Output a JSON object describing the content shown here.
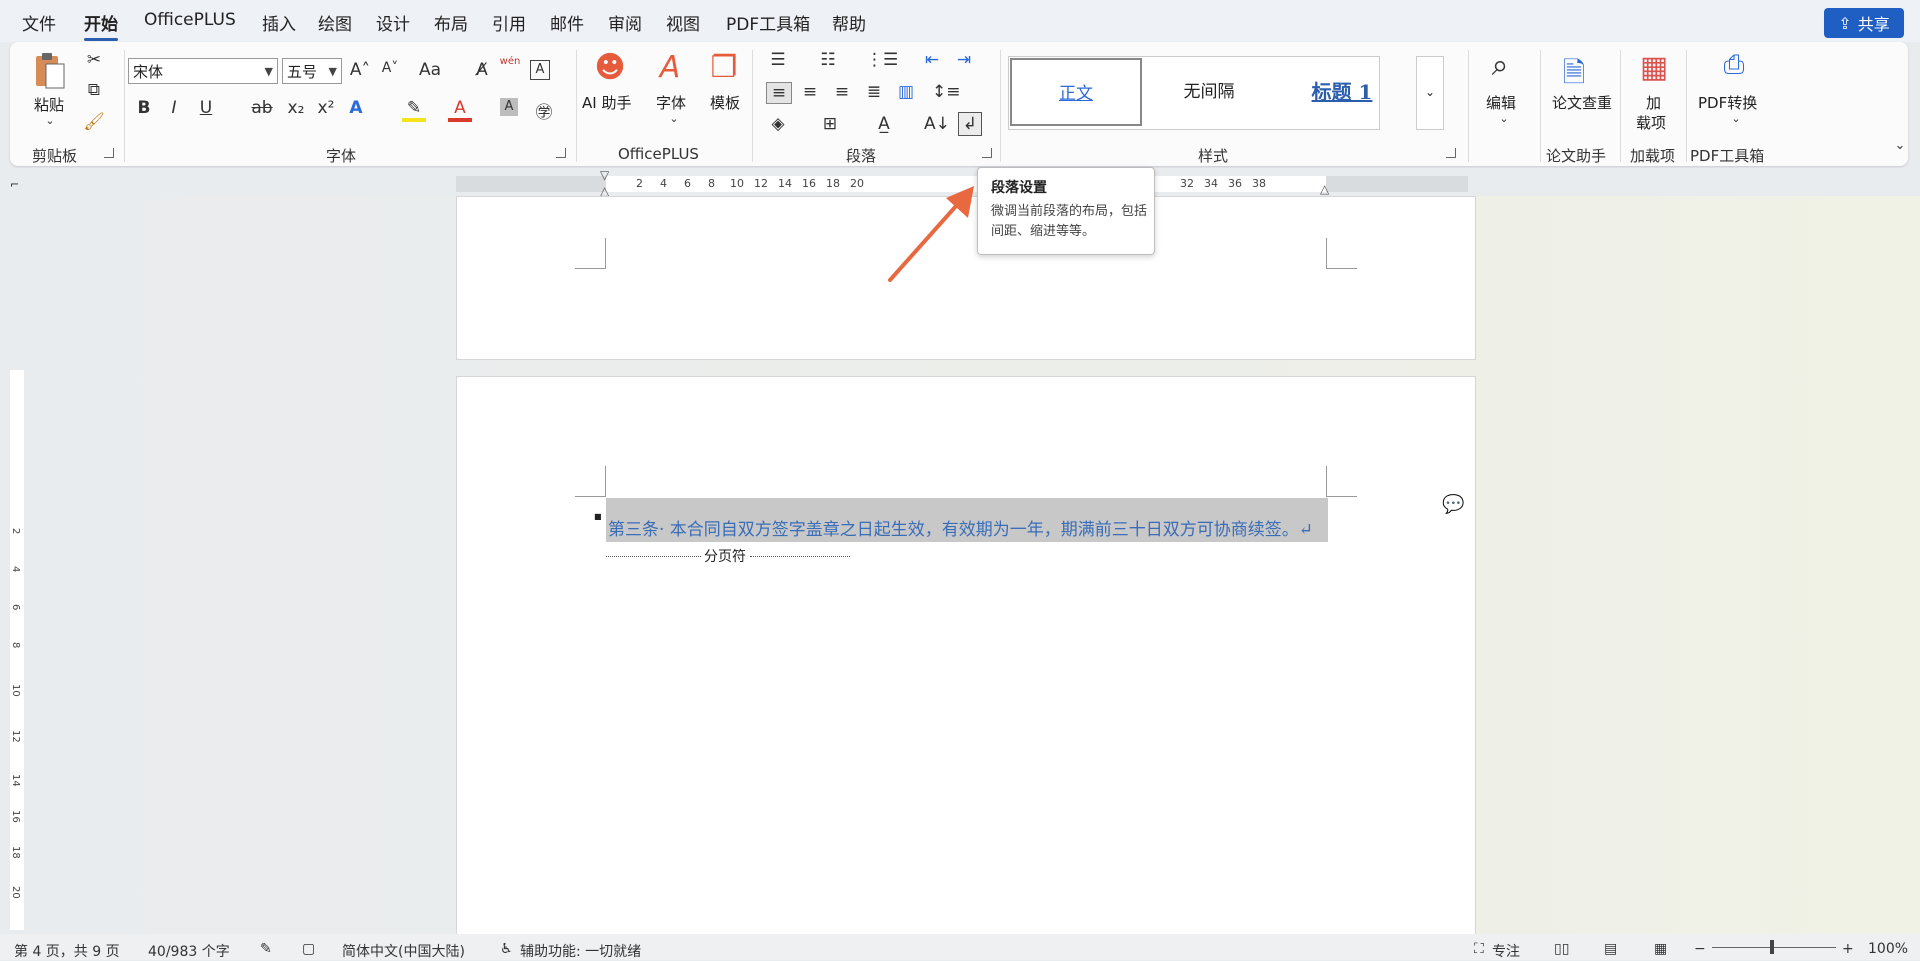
{
  "menu": {
    "items": [
      "文件",
      "开始",
      "OfficePLUS",
      "插入",
      "绘图",
      "设计",
      "布局",
      "引用",
      "邮件",
      "审阅",
      "视图",
      "PDF工具箱",
      "帮助"
    ],
    "active": "开始",
    "share_label": "共享"
  },
  "ribbon": {
    "clipboard": {
      "paste_label": "粘贴",
      "group_label": "剪贴板"
    },
    "font": {
      "font_name": "宋体",
      "font_size": "五号",
      "group_label": "字体",
      "change_case": "Aa",
      "phonetic": "wén"
    },
    "officeplus": {
      "ai_label": "AI 助手",
      "font_label": "字体",
      "template_label": "模板",
      "group_label": "OfficePLUS"
    },
    "paragraph": {
      "group_label": "段落"
    },
    "styles": {
      "items": [
        "正文",
        "无间隔",
        "标题 1"
      ],
      "group_label": "样式"
    },
    "editing": {
      "label": "编辑"
    },
    "paper": {
      "button_label": "论文查重",
      "group_label": "论文助手"
    },
    "addins": {
      "button_label_1": "加",
      "button_label_2": "载项",
      "group_label": "加载项"
    },
    "pdf": {
      "button_label": "PDF转换",
      "group_label": "PDF工具箱"
    }
  },
  "ruler": {
    "numbers": [
      "2",
      "4",
      "6",
      "8",
      "10",
      "12",
      "14",
      "16",
      "18",
      "20",
      "32",
      "34",
      "36",
      "38"
    ],
    "v_numbers": [
      "2",
      "4",
      "6",
      "8",
      "10",
      "12",
      "14",
      "16",
      "18",
      "20"
    ]
  },
  "tooltip": {
    "title": "段落设置",
    "body": "微调当前段落的布局，包括间距、缩进等等。"
  },
  "document": {
    "paragraph_text": "第三条· 本合同自双方签字盖章之日起生效，有效期为一年，期满前三十日双方可协商续签。↵",
    "page_break_label": "分页符"
  },
  "statusbar": {
    "page_info": "第 4 页，共 9 页",
    "word_count": "40/983 个字",
    "language": "简体中文(中国大陆)",
    "accessibility": "辅助功能: 一切就绪",
    "focus": "专注",
    "zoom": "100%"
  },
  "colors": {
    "accent": "#1f5ec2",
    "arrow": "#e8693f",
    "para_text": "#3a6db8"
  }
}
